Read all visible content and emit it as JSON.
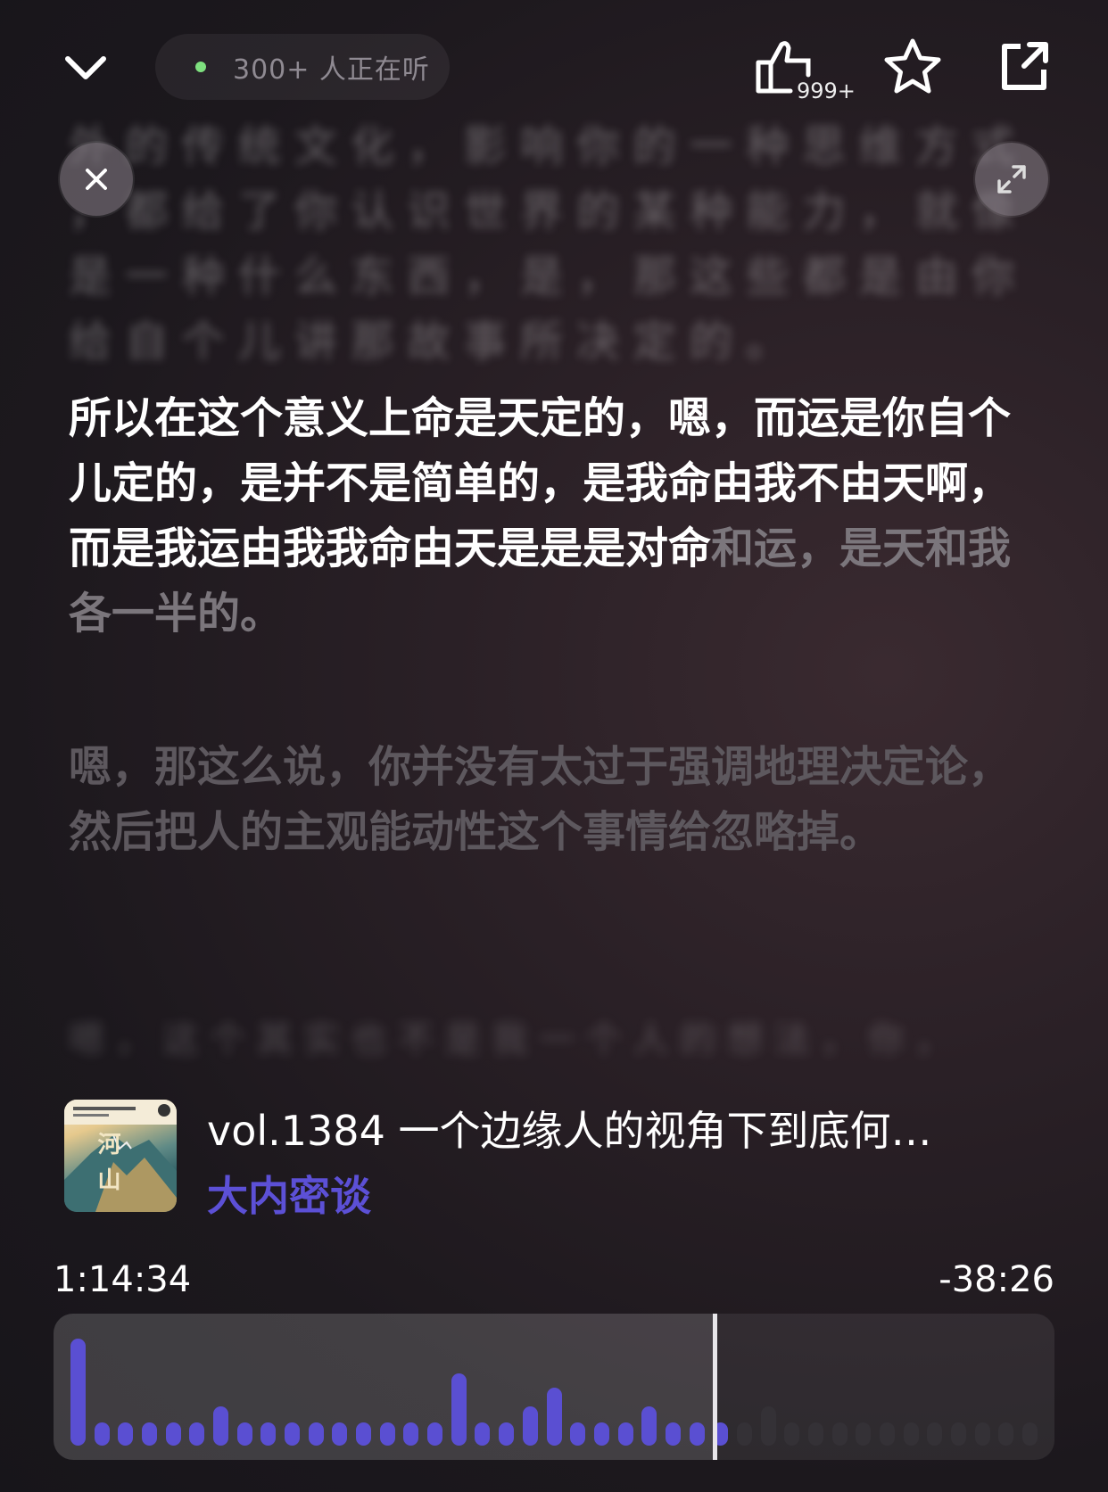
{
  "header": {
    "listeners_text": "300+ 人正在听",
    "like_count": "999+",
    "icons": {
      "collapse": "chevron-down-icon",
      "like": "thumbs-up-icon",
      "favorite": "star-icon",
      "share": "share-icon",
      "close": "close-icon",
      "expand": "expand-icon"
    },
    "status_dot_color": "#7ee07f"
  },
  "lyrics": {
    "blurred_top": "外 的 传 统 文 化 ， 影 响 你 的 一 种 思 维 方 式 ， 都 给 了 你 认 识 世 界 的 某 种 能 力 ， 就 像 是 一 种 什 么 东 西 ， 是 ， 那 这 些 都 是 由 你 给 自 个 儿 讲 那 故 事 所 决 定 的 。",
    "active_main": "所以在这个意义上命是天定的，嗯，而运是你自个儿定的，是并不是简单的，是我命由我不由天啊，而是我运由我我命由天是是是对命",
    "active_rest": "和运，是天和我各一半的。",
    "next": "嗯，那这么说，你并没有太过于强调地理决定论，然后把人的主观能动性这个事情给忽略掉。",
    "blurred_bottom": "嗯 ， 这 个 其 实 也 不 是 我 一 个 人 的 想 法 ， 你 ，"
  },
  "episode": {
    "title": "vol.1384 一个边缘人的视角下到底何…",
    "show": "大内密谈",
    "cover_text": "河山",
    "show_color": "#5c50d6"
  },
  "player": {
    "elapsed": "1:14:34",
    "remaining": "-38:26",
    "progress_fraction": 0.66,
    "played_color": "#5a4fd2",
    "unplayed_color": "#343136",
    "waveform_levels": [
      0.92,
      0.18,
      0.18,
      0.18,
      0.18,
      0.18,
      0.34,
      0.18,
      0.18,
      0.18,
      0.18,
      0.18,
      0.18,
      0.18,
      0.18,
      0.18,
      0.62,
      0.18,
      0.18,
      0.34,
      0.5,
      0.18,
      0.18,
      0.18,
      0.34,
      0.18,
      0.18,
      0.18,
      0.18,
      0.34,
      0.18,
      0.18,
      0.18,
      0.18,
      0.18,
      0.18,
      0.18,
      0.18,
      0.18,
      0.18,
      0.18
    ]
  }
}
